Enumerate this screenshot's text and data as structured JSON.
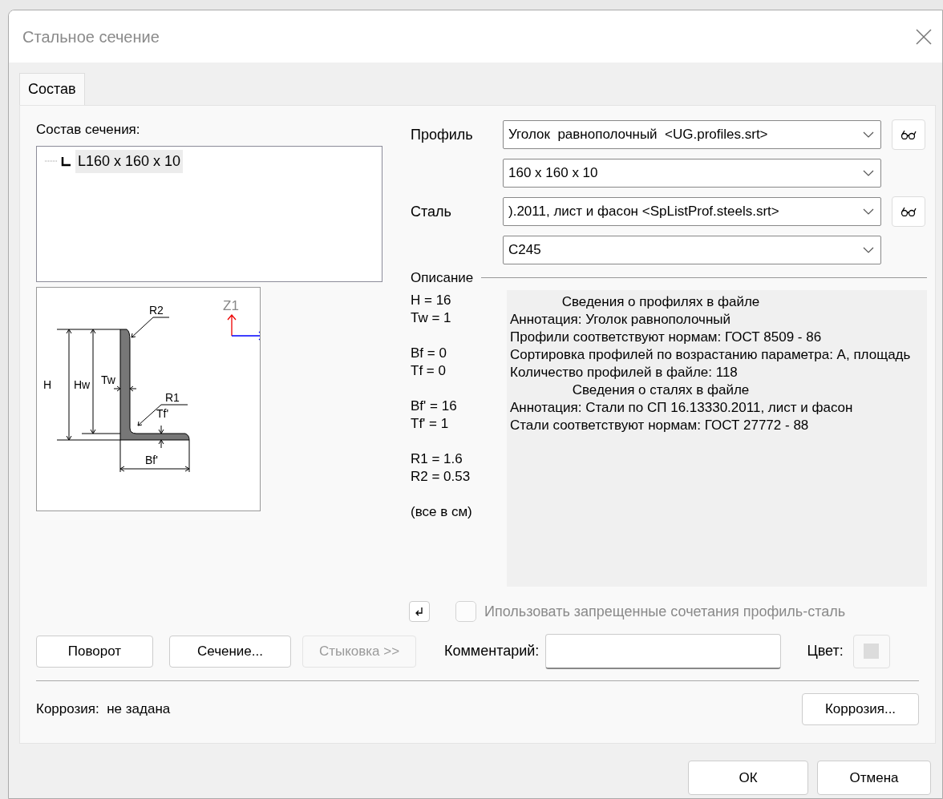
{
  "window": {
    "title": "Стальное сечение"
  },
  "tabs": [
    {
      "label": "Состав",
      "selected": true
    }
  ],
  "composition": {
    "label": "Состав сечения:",
    "items": [
      {
        "label": "L160 x 160 x 10",
        "selected": true
      }
    ]
  },
  "drawing": {
    "labels": [
      "R2",
      "H",
      "Hw",
      "Tw",
      "R1",
      "Tf'",
      "Bf'",
      "Z1"
    ]
  },
  "profile": {
    "label": "Профиль",
    "type": "Уголок  равнополочный  <UG.profiles.srt>",
    "size": "160 x 160 x 10"
  },
  "steel": {
    "label": "Сталь",
    "type": ").2011, лист и фасон <SpListProf.steels.srt>",
    "grade": "С245"
  },
  "description": {
    "label": "Описание",
    "params": [
      [
        "H = 16",
        "Tw = 1"
      ],
      [
        "Bf = 0",
        "Tf = 0"
      ],
      [
        "Bf' = 16",
        "Tf' = 1"
      ],
      [
        "R1 = 1.6",
        "R2 = 0.53"
      ],
      [
        "(все в см)"
      ]
    ],
    "lines": [
      {
        "kind": "heading",
        "text": "Сведения о профилях в файле"
      },
      {
        "kind": "text",
        "text": "Аннотация: Уголок  равнополочный"
      },
      {
        "kind": "text",
        "text": "Профили соответствуют нормам: ГОСТ 8509 - 86"
      },
      {
        "kind": "text",
        "text": "Сортировка профилей по возрастанию параметра: А, площадь"
      },
      {
        "kind": "text",
        "text": "Количество профилей в файле: 118"
      },
      {
        "kind": "heading",
        "text": "Сведения о сталях в файле"
      },
      {
        "kind": "text",
        "text": "Аннотация: Стали по СП 16.13330.2011, лист и фасон"
      },
      {
        "kind": "text",
        "text": "Стали соответствуют нормам: ГОСТ 27772 - 88"
      }
    ]
  },
  "forbidden_checkbox": {
    "label": "Ипользовать запрещенные сочетания профиль-сталь",
    "checked": false,
    "disabled": true
  },
  "buttons": [
    {
      "label": "Поворот",
      "disabled": false
    },
    {
      "label": "Сечение...",
      "disabled": false
    },
    {
      "label": "Стыковка >>",
      "disabled": true
    }
  ],
  "comment": {
    "label": "Комментарий:"
  },
  "color": {
    "label": "Цвет:",
    "color": "#dcdcdc"
  },
  "corrosion": {
    "status": "Коррозия:  не задана",
    "button": "Коррозия..."
  },
  "footer_buttons": [
    "ОК",
    "Отмена"
  ]
}
